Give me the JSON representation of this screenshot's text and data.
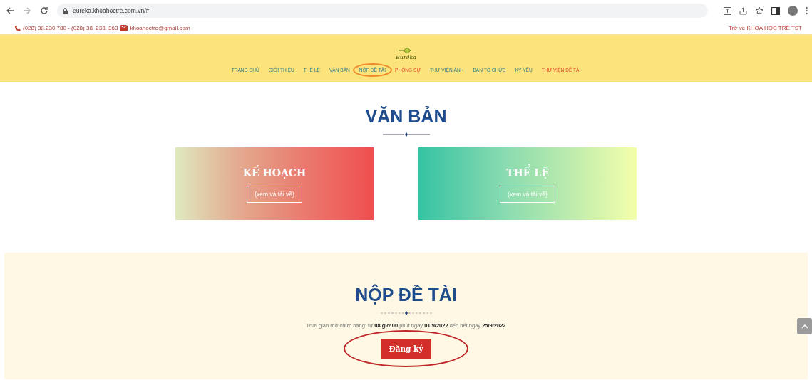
{
  "browser": {
    "url": "eureka.khoahoctre.com.vn/#"
  },
  "top_bar": {
    "phone": "(028) 38.230.780 - (028) 38. 233. 363",
    "email": "khoahoctre@gmail.com",
    "back_link": "Trở về KHOA HỌC TRẺ TST"
  },
  "logo": {
    "text": "Eurêka"
  },
  "nav": [
    {
      "label": "TRANG CHỦ",
      "highlighted": false,
      "circled": false
    },
    {
      "label": "GIỚI THIỆU",
      "highlighted": false,
      "circled": false
    },
    {
      "label": "THỂ LỆ",
      "highlighted": false,
      "circled": false
    },
    {
      "label": "VĂN BẢN",
      "highlighted": false,
      "circled": false
    },
    {
      "label": "NỘP ĐỀ TÀI",
      "highlighted": false,
      "circled": true
    },
    {
      "label": "PHÓNG SỰ",
      "highlighted": true,
      "circled": false
    },
    {
      "label": "THƯ VIỆN ẢNH",
      "highlighted": false,
      "circled": false
    },
    {
      "label": "BAN TỔ CHỨC",
      "highlighted": false,
      "circled": false
    },
    {
      "label": "KỶ YẾU",
      "highlighted": false,
      "circled": false
    },
    {
      "label": "THƯ VIỆN ĐỀ TÀI",
      "highlighted": true,
      "circled": false
    }
  ],
  "documents": {
    "title": "VĂN BẢN",
    "cards": [
      {
        "kind": "warm",
        "title": "KẾ HOẠCH",
        "button": "(xem và tải về)"
      },
      {
        "kind": "cool",
        "title": "THỂ LỆ",
        "button": "(xem và tải về)"
      }
    ]
  },
  "submission": {
    "title": "NỘP ĐỀ TÀI",
    "notice": "Thời gian mở chức năng: từ **08 giờ 00** phút ngày **01/9/2022** đến hết ngày **25/9/2022**",
    "button": "Đăng ký",
    "button_circled": true
  }
}
